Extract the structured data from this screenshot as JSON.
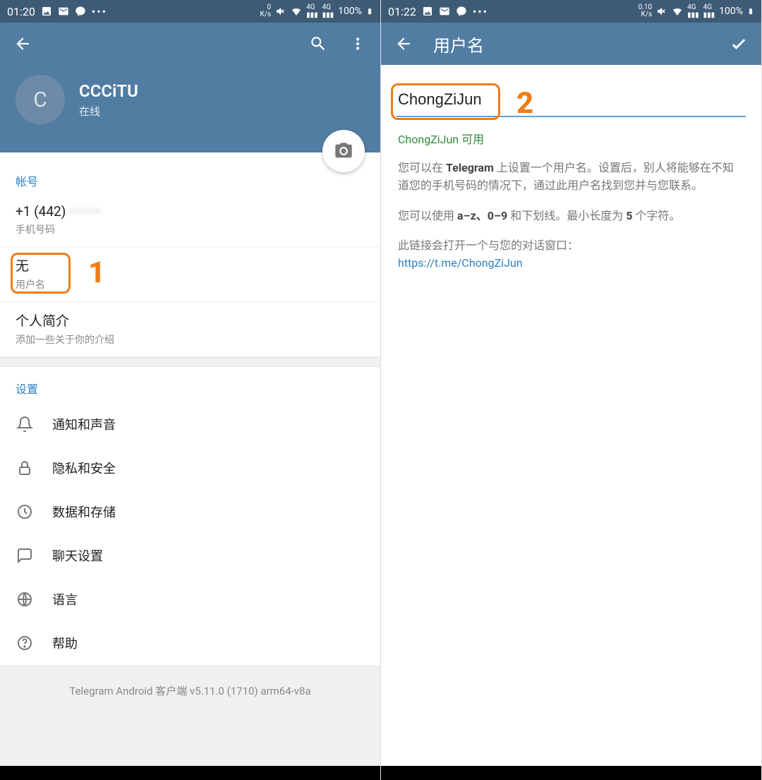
{
  "left": {
    "statusbar": {
      "time": "01:20",
      "ks": "0\nK/s",
      "net": "4G",
      "battery": "100%"
    },
    "profile": {
      "initial": "C",
      "name": "CCCiTU",
      "status": "在线"
    },
    "account": {
      "section_label": "帐号",
      "phone": {
        "value": "+1 (442)",
        "hidden": "•••••••",
        "label": "手机号码"
      },
      "username": {
        "value": "无",
        "label": "用户名"
      },
      "bio": {
        "value": "个人简介",
        "label": "添加一些关于你的介绍"
      }
    },
    "settings": {
      "section_label": "设置",
      "items": [
        {
          "label": "通知和声音",
          "icon": "bell-icon"
        },
        {
          "label": "隐私和安全",
          "icon": "lock-icon"
        },
        {
          "label": "数据和存储",
          "icon": "clock-icon"
        },
        {
          "label": "聊天设置",
          "icon": "chat-icon"
        },
        {
          "label": "语言",
          "icon": "globe-icon"
        },
        {
          "label": "帮助",
          "icon": "help-icon"
        }
      ]
    },
    "version": "Telegram Android 客户端 v5.11.0 (1710) arm64-v8a",
    "annotation": "1"
  },
  "right": {
    "statusbar": {
      "time": "01:22",
      "ks": "0.10\nK/s",
      "net": "4G",
      "battery": "100%"
    },
    "toolbar": {
      "title": "用户名"
    },
    "username_input": "ChongZiJun",
    "available": "ChongZiJun 可用",
    "help1_a": "您可以在 ",
    "help1_b": "Telegram",
    "help1_c": " 上设置一个用户名。设置后，别人将能够在不知道您的手机号码的情况下，通过此用户名找到您并与您联系。",
    "help2_a": "您可以使用 ",
    "help2_b": "a–z、0–9",
    "help2_c": " 和下划线。最小长度为 ",
    "help2_d": "5",
    "help2_e": " 个字符。",
    "help3": "此链接会打开一个与您的对话窗口：",
    "link": "https://t.me/ChongZiJun",
    "annotation": "2"
  }
}
